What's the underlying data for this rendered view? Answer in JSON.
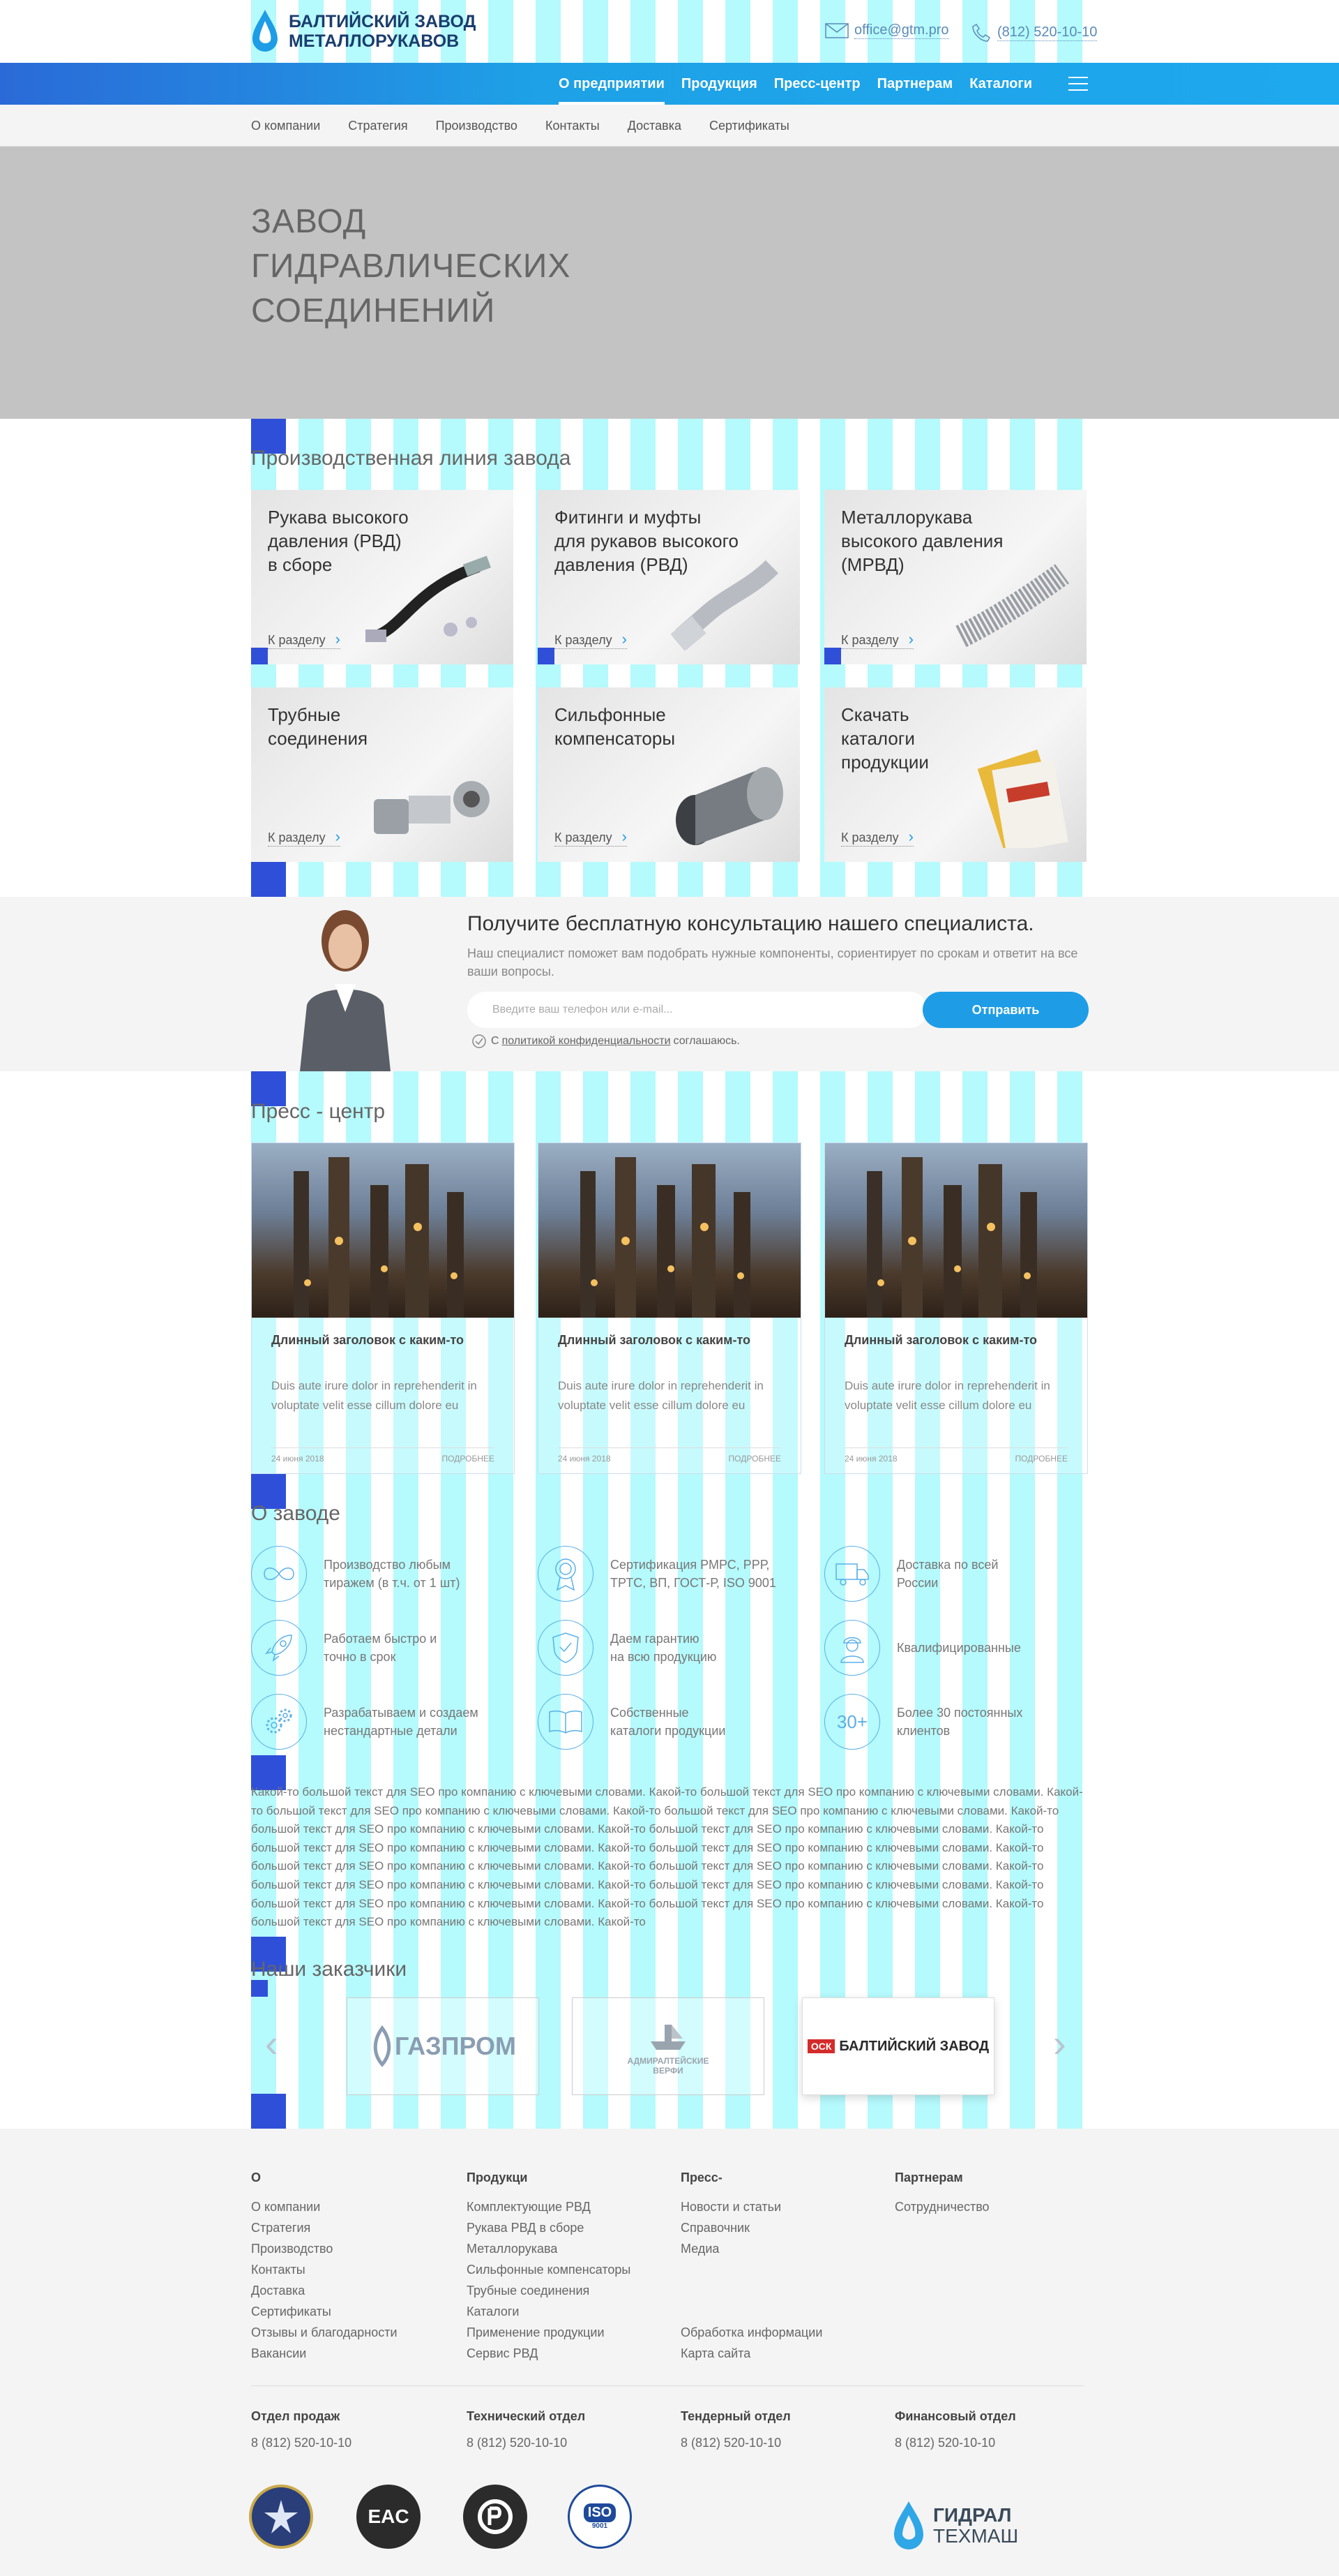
{
  "header": {
    "logo_line1": "БАЛТИЙСКИЙ ЗАВОД",
    "logo_line2": "МЕТАЛЛОРУКАВОВ",
    "email": "office@gtm.pro",
    "phone": "(812) 520-10-10"
  },
  "topnav": {
    "items": [
      "О предприятии",
      "Продукция",
      "Пресс-центр",
      "Партнерам",
      "Каталоги"
    ]
  },
  "subnav": {
    "items": [
      "О компании",
      "Стратегия",
      "Производство",
      "Контакты",
      "Доставка",
      "Сертификаты"
    ]
  },
  "hero": {
    "line1": "ЗАВОД",
    "line2": "ГИДРАВЛИЧЕСКИХ",
    "line3": "СОЕДИНЕНИЙ"
  },
  "production": {
    "title": "Производственная линия завода",
    "more_label": "К разделу",
    "cards": [
      {
        "l1": "Рукава высокого",
        "l2": "давления (РВД)",
        "l3": "в сборе"
      },
      {
        "l1": "Фитинги и муфты",
        "l2": "для рукавов высокого",
        "l3": "давления (РВД)"
      },
      {
        "l1": "Металлорукава",
        "l2": "высокого давления",
        "l3": "(МРВД)"
      },
      {
        "l1": "Трубные",
        "l2": "соединения",
        "l3": ""
      },
      {
        "l1": "Сильфонные",
        "l2": "компенсаторы",
        "l3": ""
      },
      {
        "l1": "Скачать",
        "l2": "каталоги",
        "l3": "продукции"
      }
    ]
  },
  "consult": {
    "title": "Получите бесплатную консультацию нашего специалиста.",
    "text": "Наш специалист поможет вам подобрать нужные компоненты, сориентирует по срокам и ответит на все ваши вопросы.",
    "placeholder": "Введите ваш телефон или e-mail...",
    "button": "Отправить",
    "agree_pre": "С",
    "agree_link": "политикой конфиденциальности",
    "agree_post": "соглашаюсь."
  },
  "press": {
    "title": "Пресс - центр",
    "cards": [
      {
        "title": "Длинный заголовок с каким-то",
        "text": "Duis aute irure dolor in reprehenderit in voluptate velit esse cillum dolore eu",
        "date": "24 июня 2018",
        "more": "ПОДРОБНЕЕ"
      },
      {
        "title": "Длинный заголовок с каким-то",
        "text": "Duis aute irure dolor in reprehenderit in voluptate velit esse cillum dolore eu",
        "date": "24 июня 2018",
        "more": "ПОДРОБНЕЕ"
      },
      {
        "title": "Длинный заголовок с каким-то",
        "text": "Duis aute irure dolor in reprehenderit in voluptate velit esse cillum dolore eu",
        "date": "24 июня 2018",
        "more": "ПОДРОБНЕЕ"
      }
    ]
  },
  "about": {
    "title": "О заводе",
    "features": [
      {
        "icon": "infinity-icon",
        "l1": "Производство любым",
        "l2": "тиражем (в т.ч. от 1 шт)"
      },
      {
        "icon": "certificate-medal-icon",
        "l1": "Сертификация РМРС, РРР,",
        "l2": "ТРТС, ВП, ГОСТ-Р, ISO 9001"
      },
      {
        "icon": "delivery-truck-icon",
        "l1": "Доставка по всей",
        "l2": "России"
      },
      {
        "icon": "rocket-icon",
        "l1": "Работаем быстро и",
        "l2": "точно в срок"
      },
      {
        "icon": "shield-check-icon",
        "l1": "Даем гарантию",
        "l2": "на всю продукцию"
      },
      {
        "icon": "engineer-icon",
        "l1": "Квалифицированные",
        "l2": ""
      },
      {
        "icon": "gears-icon",
        "l1": "Разрабатываем и создаем",
        "l2": "нестандартные детали"
      },
      {
        "icon": "book-icon",
        "l1": "Собственные",
        "l2": "каталоги продукции"
      },
      {
        "icon": "thirty-plus-icon",
        "l1": "Более 30 постоянных",
        "l2": "клиентов"
      }
    ],
    "badge_30": "30+",
    "seo": "Какой-то большой текст для SEO про компанию с ключевыми словами. Какой-то большой текст для SEO про компанию с ключевыми словами. Какой-то большой текст для SEO про компанию с ключевыми словами. Какой-то большой текст для SEO про компанию с ключевыми словами. Какой-то большой текст для SEO про компанию с ключевыми словами. Какой-то большой текст для SEO про компанию с ключевыми словами. Какой-то большой текст для SEO про компанию с ключевыми словами. Какой-то большой текст для SEO про компанию с ключевыми словами. Какой-то большой текст для SEO про компанию с ключевыми словами. Какой-то большой текст для SEO про компанию с ключевыми словами. Какой-то большой текст для SEO про компанию с ключевыми словами. Какой-то большой текст для SEO про компанию с ключевыми словами. Какой-то большой текст для SEO про компанию с ключевыми словами. Какой-то большой текст для SEO про компанию с ключевыми словами. Какой-то большой текст для SEO про компанию с ключевыми словами. Какой-то"
  },
  "clients": {
    "title": "Наши заказчики",
    "logos": [
      {
        "name": "ГАЗПРОМ"
      },
      {
        "name": "АДМИРАЛТЕЙСКИЕ",
        "name2": "ВЕРФИ"
      },
      {
        "name": "БАЛТИЙСКИЙ ЗАВОД",
        "abbr": "ОСК"
      }
    ]
  },
  "footer": {
    "cols": [
      {
        "title": "О",
        "items": [
          "О компании",
          "Стратегия",
          "Производство",
          "Контакты",
          "Доставка",
          "Сертификаты",
          "Отзывы и благодарности",
          "Вакансии"
        ]
      },
      {
        "title": "Продукци",
        "items": [
          "Комплектующие РВД",
          "Рукава РВД в сборе",
          "Металлорукава",
          "Сильфонные компенсаторы",
          "Трубные соединения",
          "Каталоги",
          "Применение продукции",
          "Сервис РВД"
        ]
      },
      {
        "title": "Пресс-",
        "items": [
          "Новости и статьи",
          "Справочник",
          "Медиа"
        ],
        "extra": [
          "Обработка информации",
          "Карта сайта"
        ]
      },
      {
        "title": "Партнерам",
        "items": [
          "Сотрудничество"
        ]
      }
    ],
    "contacts": [
      {
        "title": "Отдел продаж",
        "phone": "8 (812) 520-10-10"
      },
      {
        "title": "Технический отдел",
        "phone": "8 (812) 520-10-10"
      },
      {
        "title": "Тендерный отдел",
        "phone": "8 (812) 520-10-10"
      },
      {
        "title": "Финансовый отдел",
        "phone": "8 (812) 520-10-10"
      }
    ],
    "certs": {
      "eac": "EAC",
      "iso": "ISO",
      "iso_num": "9001"
    },
    "brand_line1": "ГИДРАЛ",
    "brand_line2": "ТЕХМАШ"
  },
  "colors": {
    "accent": "#1e9de6",
    "nav_start": "#2a6ad8",
    "grid_overlay": "#78f5fa",
    "marker": "#2f4fd8"
  }
}
